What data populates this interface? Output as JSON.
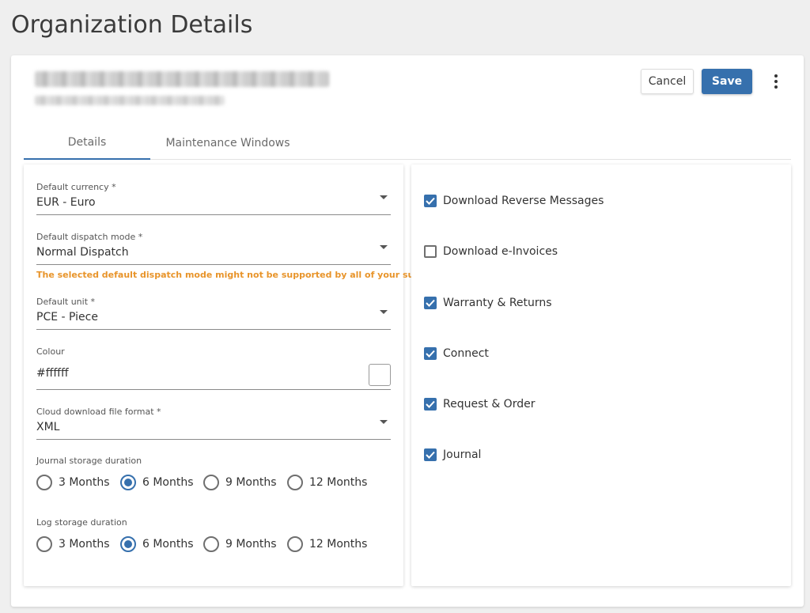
{
  "page_title": "Organization Details",
  "header": {
    "cancel_label": "Cancel",
    "save_label": "Save"
  },
  "tabs": [
    {
      "label": "Details",
      "active": true
    },
    {
      "label": "Maintenance Windows",
      "active": false
    }
  ],
  "form": {
    "currency": {
      "label": "Default currency *",
      "value": "EUR - Euro"
    },
    "dispatch": {
      "label": "Default dispatch mode *",
      "value": "Normal Dispatch",
      "warning": "The selected default dispatch mode might not be supported by all of your suppliers"
    },
    "unit": {
      "label": "Default unit *",
      "value": "PCE - Piece"
    },
    "colour": {
      "label": "Colour",
      "value": "#ffffff",
      "swatch_color": "#ffffff"
    },
    "file_format": {
      "label": "Cloud download file format *",
      "value": "XML"
    },
    "journal_storage": {
      "label": "Journal storage duration",
      "options": [
        "3 Months",
        "6 Months",
        "9 Months",
        "12 Months"
      ],
      "selected": "6 Months"
    },
    "log_storage": {
      "label": "Log storage duration",
      "options": [
        "3 Months",
        "6 Months",
        "9 Months",
        "12 Months"
      ],
      "selected": "6 Months"
    }
  },
  "options": [
    {
      "label": "Download Reverse Messages",
      "checked": true
    },
    {
      "label": "Download e-Invoices",
      "checked": false
    },
    {
      "label": "Warranty & Returns",
      "checked": true
    },
    {
      "label": "Connect",
      "checked": true
    },
    {
      "label": "Request & Order",
      "checked": true
    },
    {
      "label": "Journal",
      "checked": true
    }
  ],
  "colors": {
    "accent": "#3670ad",
    "warning": "#e8942a",
    "background": "#efefef"
  },
  "icons": {
    "more": "kebab-vertical-icon",
    "dropdown": "caret-down-icon",
    "check": "check-icon"
  }
}
